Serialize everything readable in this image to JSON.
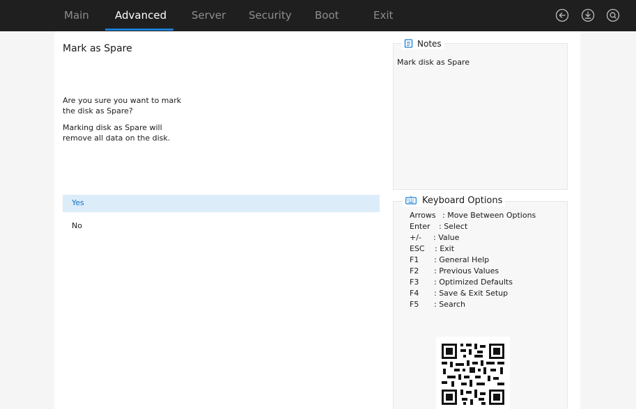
{
  "tabs": [
    {
      "label": "Main",
      "active": false
    },
    {
      "label": "Advanced",
      "active": true
    },
    {
      "label": "Server",
      "active": false
    },
    {
      "label": "Security",
      "active": false
    },
    {
      "label": "Boot",
      "active": false
    },
    {
      "label": "Exit",
      "active": false
    }
  ],
  "top_icons": [
    "back-icon",
    "save-icon",
    "search-icon"
  ],
  "page": {
    "title": "Mark as Spare",
    "question_line1": "Are you sure you want to mark",
    "question_line2": "the disk as Spare?",
    "warning_line1": "Marking disk as Spare will",
    "warning_line2": "remove all data on the disk."
  },
  "options": {
    "yes": "Yes",
    "no": "No",
    "selected": "Yes"
  },
  "notes": {
    "title": "Notes",
    "text": "Mark disk as Spare"
  },
  "keyboard": {
    "title": "Keyboard Options",
    "items": [
      {
        "key": "Arrows",
        "desc": ": Move Between Options"
      },
      {
        "key": "Enter",
        "desc": ": Select"
      },
      {
        "key": "+/-",
        "desc": ": Value"
      },
      {
        "key": "ESC",
        "desc": ": Exit"
      },
      {
        "key": "F1",
        "desc": ": General Help"
      },
      {
        "key": "F2",
        "desc": ": Previous Values"
      },
      {
        "key": "F3",
        "desc": ": Optimized Defaults"
      },
      {
        "key": "F4",
        "desc": ": Save & Exit Setup"
      },
      {
        "key": "F5",
        "desc": ": Search"
      }
    ]
  },
  "colors": {
    "topbar": "#1f1f1f",
    "accent": "#1a7fd4",
    "selected_bg": "#dcecf9",
    "selected_text": "#1b6fc2"
  }
}
